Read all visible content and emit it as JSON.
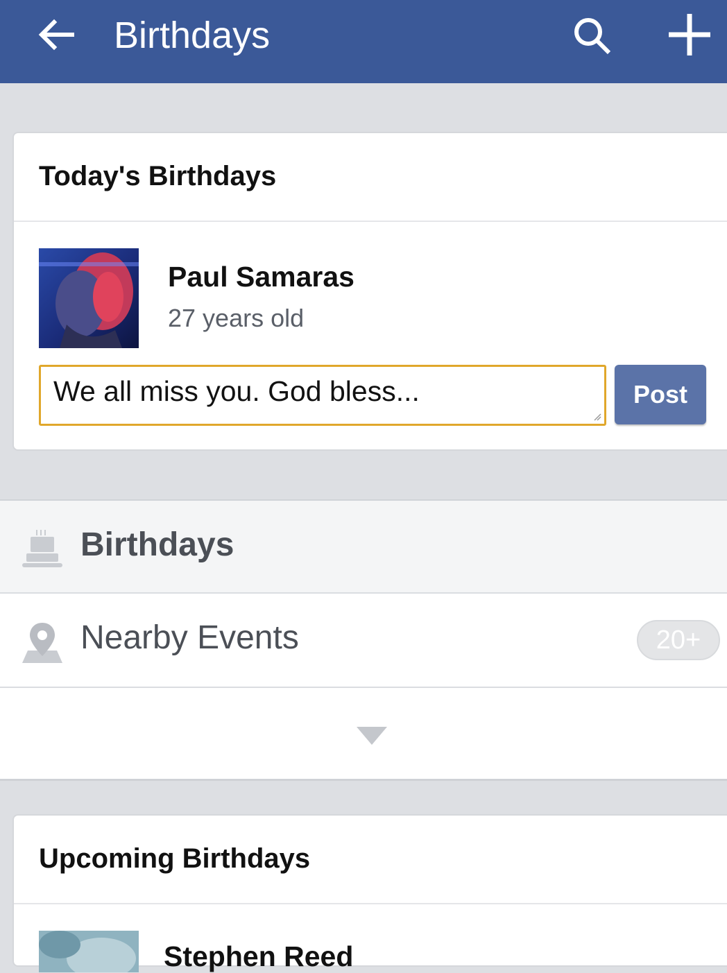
{
  "appbar": {
    "title": "Birthdays",
    "back_icon": "arrow-left-icon",
    "search_icon": "search-icon",
    "add_icon": "plus-icon",
    "color": "#3b5998"
  },
  "today": {
    "heading": "Today's Birthdays",
    "person": {
      "name": "Paul Samaras",
      "age": "27 years old"
    },
    "message": {
      "value": "We all miss you. God bless..."
    },
    "post_label": "Post"
  },
  "menu": {
    "birthdays": {
      "label": "Birthdays",
      "icon": "cake-icon"
    },
    "nearby": {
      "label": "Nearby Events",
      "icon": "map-pin-icon",
      "badge": "20+"
    },
    "more_icon": "chevron-down-icon"
  },
  "upcoming": {
    "heading": "Upcoming Birthdays",
    "person": {
      "name": "Stephen Reed"
    }
  }
}
